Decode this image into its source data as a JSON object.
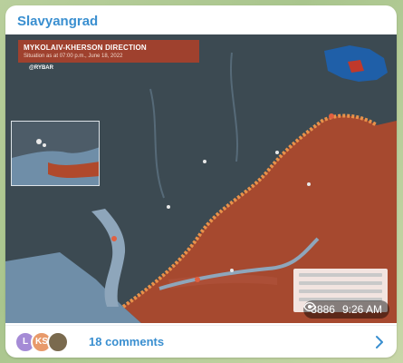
{
  "channel": {
    "name": "Slavyangrad"
  },
  "map": {
    "title": "MYKOLAIV-KHERSON DIRECTION",
    "subtitle": "Situation as at 07:00 p.m., June 18, 2022",
    "brand": "@RYBAR",
    "colors": {
      "water": "#6f8ea8",
      "land": "#3c4a52",
      "occupied": "#b0492c",
      "frontline": "#e8924a"
    }
  },
  "post": {
    "views": "3886",
    "time": "9:26 AM"
  },
  "footer": {
    "avatars": [
      {
        "initials": "L",
        "color": "#a58bd6"
      },
      {
        "initials": "KS",
        "color": "#e89a6b"
      },
      {
        "initials": "",
        "color": "#7a6a4e"
      }
    ],
    "comments_label": "18 comments"
  }
}
